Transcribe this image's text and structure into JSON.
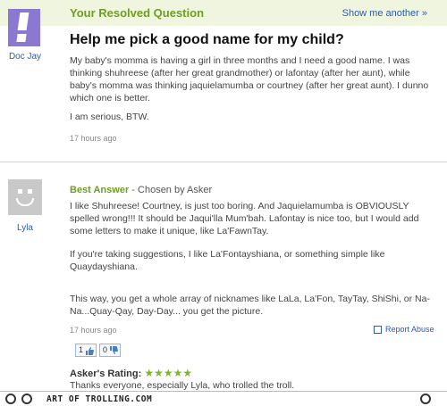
{
  "question": {
    "header_title": "Your Resolved Question",
    "show_more": "Show me another »",
    "asker": "Doc Jay",
    "title": "Help me pick a good name for my child?",
    "body": "My baby's momma is having a girl in three months and I need a good name. I was thinking shuhreese (after her great grandmother) or lafontay (after her aunt), while baby's momma was thinking jaquielamumba or courtney (after her great aunt). I dunno which one is better.",
    "btw": "I am serious, BTW.",
    "time": "17 hours ago"
  },
  "answer": {
    "answerer": "Lyla",
    "best_label": "Best Answer",
    "chosen_by": " - Chosen by Asker",
    "p1": "I like Shuhreese! Courtney, is just too boring. And Jaquielamumba is OBVIOUSLY spelled wrong!!! It should be Jaqui'lla Mum'bah. Lafontay is nice too, but I would add some letters to make it unique, like La'FawnTay.",
    "p2": "If you're taking suggestions, I like La'Fontayshiana, or something simple like Quaydayshiana.",
    "p3": "This way, you get a whole array of nicknames like LaLa, La'Fon, TayTay, ShiShi, or Na-Na...Quay-Qay, Day-Day... you get the picture.",
    "time": "17 hours ago",
    "report": "Report Abuse",
    "votes_up": "1",
    "votes_down": "0",
    "rating_label": "Asker's Rating:",
    "stars": "★★★★★",
    "rating_comment": "Thanks everyone, especially Lyla, who trolled the troll."
  },
  "footer": {
    "text": "ART OF TROLLING.COM"
  },
  "colors": {
    "accent_green": "#6f9d22",
    "link_blue": "#2a5db0",
    "header_bg": "#f0f5df",
    "asker_avatar": "#8b78d0",
    "answerer_avatar": "#c9c9c9"
  }
}
